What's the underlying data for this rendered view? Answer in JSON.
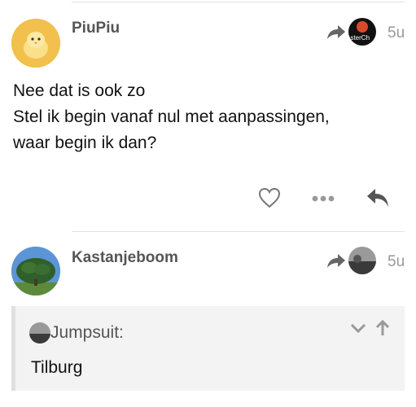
{
  "posts": [
    {
      "username": "PiuPiu",
      "reply_to_avatar_text": "asterCh",
      "time": "5u",
      "lines": [
        "Nee dat is ook zo",
        "Stel ik begin vanaf nul met aanpassingen,",
        "waar begin ik dan?"
      ]
    },
    {
      "username": "Kastanjeboom",
      "time": "5u",
      "quote": {
        "username": "Jumpsuit:",
        "text": "Tilburg"
      }
    }
  ],
  "colors": {
    "text": "#111111",
    "muted": "#999999",
    "icon": "#555555",
    "quote_bg": "#f3f3f3"
  }
}
